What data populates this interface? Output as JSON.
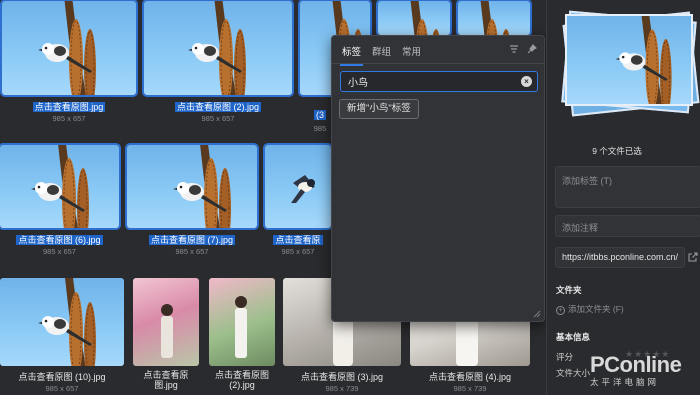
{
  "grid": {
    "row1": [
      {
        "caption": "点击查看原图.jpg",
        "dims": "985 x 657"
      },
      {
        "caption": "点击查看原图 (2).jpg",
        "dims": "985 x 657"
      },
      {
        "caption": "(3",
        "dims": "985"
      },
      {
        "caption": "",
        "dims": ""
      },
      {
        "caption": "",
        "dims": ""
      }
    ],
    "row2": [
      {
        "caption": "点击查看原图 (6).jpg",
        "dims": "985 x 657"
      },
      {
        "caption": "点击查看原图 (7).jpg",
        "dims": "985 x 657"
      },
      {
        "caption": "点击查看原",
        "dims": "985 x 657"
      }
    ],
    "row3": [
      {
        "caption": "点击查看原图 (10).jpg",
        "dims": "985 x 657"
      },
      {
        "caption": "点击查看原图.jpg",
        "dims": ""
      },
      {
        "caption": "点击查看原图 (2).jpg",
        "dims": ""
      },
      {
        "caption": "点击查看原图 (3).jpg",
        "dims": "985 x 739"
      },
      {
        "caption": "点击查看原图 (4).jpg",
        "dims": "985 x 739"
      }
    ]
  },
  "popup": {
    "tabs": [
      "标签",
      "群组",
      "常用"
    ],
    "search_value": "小鸟",
    "new_tag_label": "新增\"小鸟\"标签"
  },
  "panel": {
    "selected_count": "9 个文件已选",
    "tags_placeholder": "添加标签 (T)",
    "note_placeholder": "添加注释",
    "url": "https://itbbs.pconline.com.cn/",
    "folder_title": "文件夹",
    "add_folder": "添加文件夹 (F)",
    "info_title": "基本信息",
    "rating_label": "评分",
    "size_label": "文件大小"
  },
  "watermark": {
    "logo": "PConline",
    "sub": "太平洋电脑网"
  },
  "colors": {
    "accent": "#2f7ae5",
    "selection": "#1f64c8",
    "background": "#2a2b2e"
  }
}
